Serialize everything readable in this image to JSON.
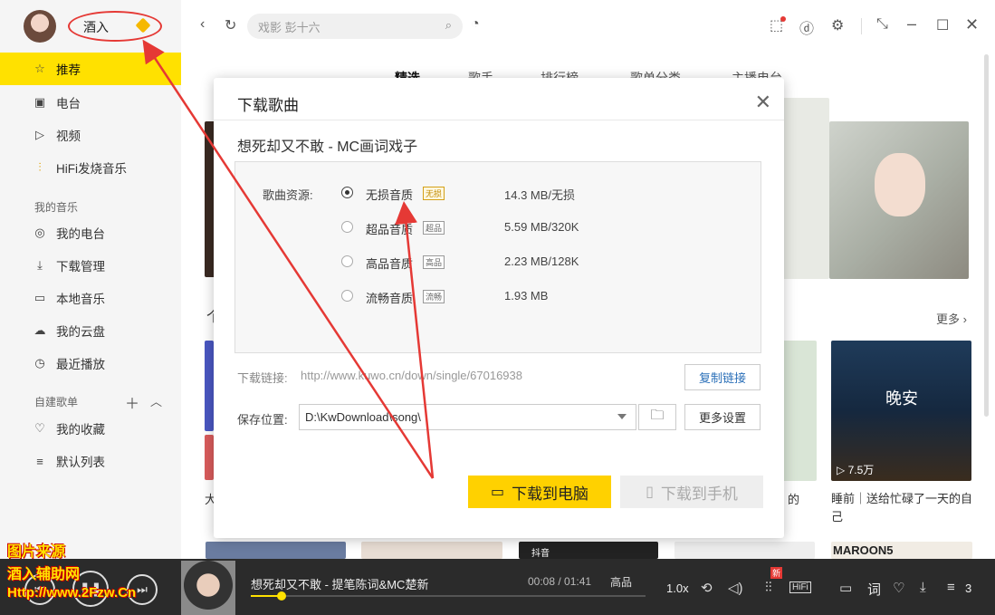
{
  "user": {
    "name": "酒入"
  },
  "sidebar": {
    "items": [
      {
        "label": "推荐",
        "icon": "star-icon"
      },
      {
        "label": "电台",
        "icon": "radio-icon"
      },
      {
        "label": "视频",
        "icon": "video-icon"
      },
      {
        "label": "HiFi发烧音乐",
        "icon": "hifi-icon"
      }
    ],
    "my_music_title": "我的音乐",
    "my_music": [
      {
        "label": "我的电台"
      },
      {
        "label": "下载管理"
      },
      {
        "label": "本地音乐"
      },
      {
        "label": "我的云盘"
      },
      {
        "label": "最近播放"
      }
    ],
    "playlist_title": "自建歌单",
    "playlists": [
      {
        "label": "我的收藏"
      },
      {
        "label": "默认列表"
      }
    ]
  },
  "topbar": {
    "search_placeholder": "戏影 彭十六",
    "tabs": [
      "精选",
      "歌手",
      "排行榜",
      "歌单分类",
      "主播电台"
    ]
  },
  "content": {
    "more": "更多 ›",
    "play_count": "▷ 7.5万",
    "card_caption": "睡前｜送给忙碌了一天的自己",
    "card_caption_2": "的",
    "card_caption_left": "大",
    "section_glyph": "个",
    "tile_text": "晚安",
    "maroon": "MAROON5",
    "douyin": "抖音"
  },
  "dialog": {
    "title": "下载歌曲",
    "song": "想死却又不敢  - MC画词戏子",
    "source_label": "歌曲资源:",
    "options": [
      {
        "name": "无损音质",
        "tag": "无损",
        "size": "14.3  MB/无损",
        "selected": true
      },
      {
        "name": "超品音质",
        "tag": "超品",
        "size": "5.59 MB/320K",
        "selected": false
      },
      {
        "name": "高品音质",
        "tag": "高品",
        "size": "2.23 MB/128K",
        "selected": false
      },
      {
        "name": "流畅音质",
        "tag": "流畅",
        "size": "1.93 MB",
        "selected": false
      }
    ],
    "link_label": "下载链接:",
    "link": "http://www.kuwo.cn/down/single/67016938",
    "copy_btn": "复制链接",
    "save_label": "保存位置:",
    "save_path": "D:\\KwDownload\\song\\",
    "more_settings": "更多设置",
    "download_pc": "下载到电脑",
    "download_phone": "下载到手机"
  },
  "player": {
    "track": "想死却又不敢  - 提笔陈词&MC楚新",
    "time": "00:08 / 01:41",
    "quality": "高品",
    "speed": "1.0x",
    "new_badge": "新",
    "hifi": "HiFi",
    "lyric": "词",
    "count": "3"
  },
  "watermark": {
    "line1": "图片来源",
    "line2": "酒入辅助网",
    "line3": "Http://www.2Fzw.Cn"
  },
  "colors": {
    "accent": "#ffe100",
    "annotation": "#e53935"
  }
}
